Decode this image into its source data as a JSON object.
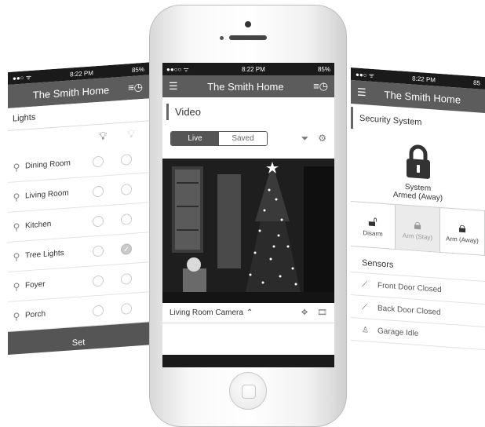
{
  "left_screen": {
    "status": {
      "time": "8:22 PM",
      "battery": "85%"
    },
    "title": "The Smith Home",
    "section_title": "Lights",
    "lights": [
      {
        "name": "Dining Room",
        "on": false
      },
      {
        "name": "Living Room",
        "on": false
      },
      {
        "name": "Kitchen",
        "on": false
      },
      {
        "name": "Tree Lights",
        "on": true
      },
      {
        "name": "Foyer",
        "on": false
      },
      {
        "name": "Porch",
        "on": false
      }
    ],
    "set_label": "Set"
  },
  "center_screen": {
    "status": {
      "time": "8:22 PM",
      "battery": "85%"
    },
    "title": "The Smith Home",
    "section_title": "Video",
    "segments": {
      "live": "Live",
      "saved": "Saved",
      "selected": "Live"
    },
    "camera_name": "Living Room Camera"
  },
  "right_screen": {
    "status": {
      "time": "8:22 PM",
      "battery": "85"
    },
    "title": "The Smith Home",
    "section_title": "Security System",
    "system_status_line1": "System",
    "system_status_line2": "Armed (Away)",
    "arm_modes": [
      {
        "label": "Disarm",
        "active": false
      },
      {
        "label": "Arm (Stay)",
        "active": true
      },
      {
        "label": "Arm (Away)",
        "active": false
      }
    ],
    "sensors_title": "Sensors",
    "sensors": [
      {
        "label": "Front Door Closed",
        "icon": "door-sensor-icon"
      },
      {
        "label": "Back Door Closed",
        "icon": "door-sensor-icon"
      },
      {
        "label": "Garage Idle",
        "icon": "person-icon"
      }
    ]
  }
}
